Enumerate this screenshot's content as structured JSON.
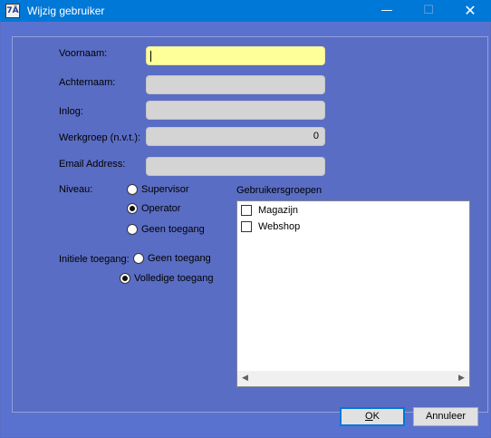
{
  "window": {
    "title": "Wijzig gebruiker",
    "icon_text": "7Ä",
    "minimize_glyph": "—",
    "maximize_glyph": "☐",
    "close_glyph": "✕"
  },
  "form": {
    "first_name": {
      "label": "Voornaam:",
      "value": ""
    },
    "last_name": {
      "label": "Achternaam:",
      "value": ""
    },
    "login": {
      "label": "Inlog:",
      "value": ""
    },
    "workgroup": {
      "label": "Werkgroep (n.v.t.):",
      "value": "0"
    },
    "email": {
      "label": "Email Address:",
      "value": ""
    }
  },
  "level": {
    "label": "Niveau:",
    "options": [
      "Supervisor",
      "Operator",
      "Geen toegang"
    ],
    "selected": "Operator"
  },
  "initial_access": {
    "label": "Initiele toegang:",
    "options": [
      "Geen toegang",
      "Volledige toegang"
    ],
    "selected": "Volledige toegang"
  },
  "user_groups": {
    "label": "Gebruikersgroepen",
    "items": [
      {
        "label": "Magazijn",
        "checked": false
      },
      {
        "label": "Webshop",
        "checked": false
      }
    ]
  },
  "buttons": {
    "ok_mnemonic": "O",
    "ok_rest": "K",
    "cancel": "Annuleer"
  },
  "colors": {
    "title_bar": "#0078d7",
    "dialog_background": "#5a6dc4",
    "focused_field": "#ffff99"
  }
}
